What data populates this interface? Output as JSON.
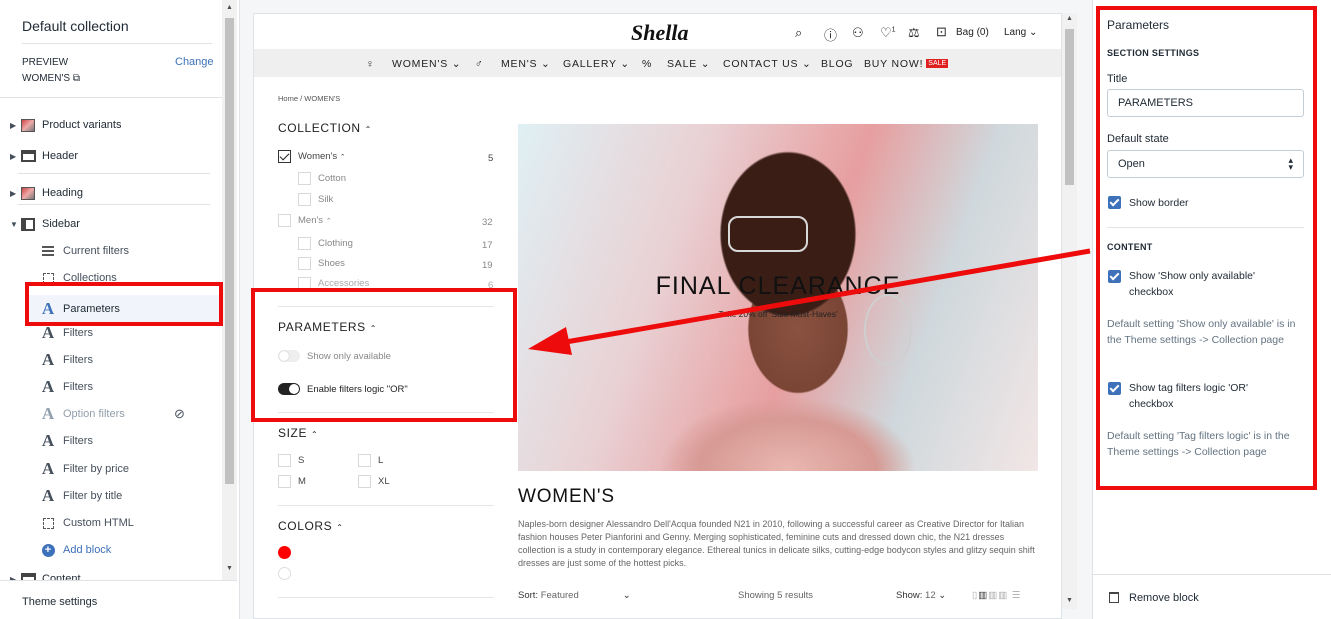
{
  "left_panel": {
    "title": "Default collection",
    "preview_label": "PREVIEW",
    "change_link": "Change",
    "preview_value": "WOMEN'S",
    "tree": [
      {
        "label": "Product variants",
        "icon": "image-thumbnail-icon"
      },
      {
        "label": "Header",
        "icon": "header-layout-icon"
      },
      {
        "label": "Heading",
        "icon": "image-thumbnail-icon"
      },
      {
        "label": "Sidebar",
        "icon": "sidebar-layout-icon"
      }
    ],
    "sidebar_blocks": [
      {
        "label": "Current filters",
        "icon": "list-lines-icon"
      },
      {
        "label": "Collections",
        "icon": "dashed-box-icon"
      },
      {
        "label": "Parameters",
        "icon": "text-a-icon"
      },
      {
        "label": "Filters",
        "icon": "text-a-icon"
      },
      {
        "label": "Filters",
        "icon": "text-a-icon"
      },
      {
        "label": "Filters",
        "icon": "text-a-icon"
      },
      {
        "label": "Option filters",
        "icon": "text-a-icon"
      },
      {
        "label": "Filters",
        "icon": "text-a-icon"
      },
      {
        "label": "Filter by price",
        "icon": "text-a-icon"
      },
      {
        "label": "Filter by title",
        "icon": "text-a-icon"
      },
      {
        "label": "Custom HTML",
        "icon": "dashed-box-icon"
      },
      {
        "label": "Add block",
        "icon": "add-circle-icon"
      }
    ],
    "content_label": "Content",
    "theme_settings": "Theme settings"
  },
  "store": {
    "logo": "Shella",
    "wishlist_count": "1",
    "bag": "Bag (0)",
    "lang": "Lang",
    "nav": [
      "WOMEN'S",
      "MEN'S",
      "GALLERY",
      "SALE",
      "CONTACT US",
      "BLOG",
      "BUY NOW!"
    ],
    "sale_badge": "SALE",
    "breadcrumb_home": "Home",
    "breadcrumb_sep": "/",
    "breadcrumb_current": "WOMEN'S",
    "collection_heading": "COLLECTION",
    "collection_items": [
      {
        "label": "Women's",
        "count": "5",
        "checked": true
      },
      {
        "label": "Cotton",
        "count": ""
      },
      {
        "label": "Silk",
        "count": ""
      },
      {
        "label": "Men's",
        "count": "32"
      },
      {
        "label": "Clothing",
        "count": "17"
      },
      {
        "label": "Shoes",
        "count": "19"
      },
      {
        "label": "Accessories",
        "count": "6"
      }
    ],
    "parameters_heading": "PARAMETERS",
    "param_show_available": "Show only available",
    "param_filters_logic": "Enable filters logic \"OR\"",
    "size_heading": "SIZE",
    "sizes": [
      "S",
      "L",
      "M",
      "XL"
    ],
    "colors_heading": "COLORS",
    "color_swatches": [
      "#ff0000",
      "#ffffff"
    ],
    "hero_title": "FINAL CLEARANCE",
    "hero_subtitle": "Take 20% off 'Sale Must-Haves'",
    "page_title": "WOMEN'S",
    "description": "Naples-born designer Alessandro Dell'Acqua founded N21 in 2010, following a successful career as Creative Director for Italian fashion houses Peter Pianforini and Genny. Merging sophisticated, feminine cuts and dressed down chic, the N21 dresses collection is a study in contemporary elegance. Ethereal tunics in delicate silks, cutting-edge bodycon styles and glitzy sequin shift dresses are just some of the hottest picks.",
    "sort_label": "Sort:",
    "sort_value": "Featured",
    "results": "Showing 5 results",
    "show_label": "Show:",
    "show_value": "12"
  },
  "right_panel": {
    "title": "Parameters",
    "section_settings": "SECTION SETTINGS",
    "title_label": "Title",
    "title_value": "PARAMETERS",
    "default_state_label": "Default state",
    "default_state_value": "Open",
    "show_border": "Show border",
    "content_heading": "CONTENT",
    "show_available_cb": "Show 'Show only available' checkbox",
    "show_available_help": "Default setting 'Show only available' is in the Theme settings -> Collection page",
    "tag_logic_cb": "Show tag filters logic 'OR' checkbox",
    "tag_logic_help": "Default setting 'Tag filters logic' is in the Theme settings -> Collection page",
    "remove_block": "Remove block"
  },
  "colors": {
    "accent": "#3d71b9",
    "annotation": "#ee0b0b",
    "sale": "#e02020"
  }
}
